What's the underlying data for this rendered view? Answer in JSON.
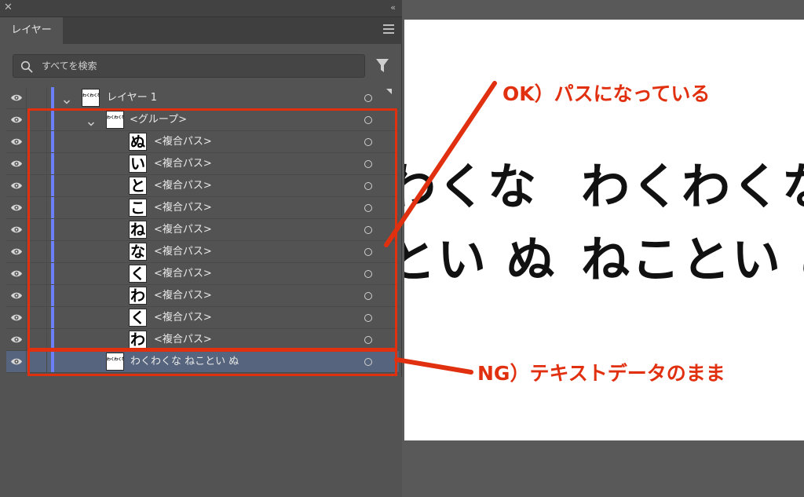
{
  "panel": {
    "tab_label": "レイヤー",
    "search_placeholder": "すべてを検索",
    "layers": [
      {
        "name": "レイヤー 1",
        "thumb": "わくわくな ねことい",
        "expanded": true,
        "type": "layer",
        "selected_indicator": true
      },
      {
        "name": "<グループ>",
        "thumb": "わくわくな ねことい",
        "expanded": true,
        "type": "group"
      },
      {
        "name": "<複合パス>",
        "thumb": "ぬ",
        "type": "compound-path"
      },
      {
        "name": "<複合パス>",
        "thumb": "い",
        "type": "compound-path"
      },
      {
        "name": "<複合パス>",
        "thumb": "と",
        "type": "compound-path"
      },
      {
        "name": "<複合パス>",
        "thumb": "こ",
        "type": "compound-path"
      },
      {
        "name": "<複合パス>",
        "thumb": "ね",
        "type": "compound-path"
      },
      {
        "name": "<複合パス>",
        "thumb": "な",
        "type": "compound-path"
      },
      {
        "name": "<複合パス>",
        "thumb": "く",
        "type": "compound-path"
      },
      {
        "name": "<複合パス>",
        "thumb": "わ",
        "type": "compound-path"
      },
      {
        "name": "<複合パス>",
        "thumb": "く",
        "type": "compound-path"
      },
      {
        "name": "<複合パス>",
        "thumb": "わ",
        "type": "compound-path"
      },
      {
        "name": "わくわくな ねことい ぬ",
        "thumb": "わくわくな ねことい",
        "type": "text",
        "selected": true
      }
    ]
  },
  "artboard": {
    "left_line1": "わくな",
    "left_line2": "とい ぬ",
    "right_line1": "わくわくな",
    "right_line2": "ねことい ぬ"
  },
  "annotations": {
    "ok_label": "OK）パスになっている",
    "ng_label": "NG）テキストデータのまま",
    "accent_color": "#e0300f"
  },
  "colors": {
    "panel_bg": "#535353",
    "layer_color_bar": "#6b7ff8",
    "selected_row": "#56657d"
  }
}
